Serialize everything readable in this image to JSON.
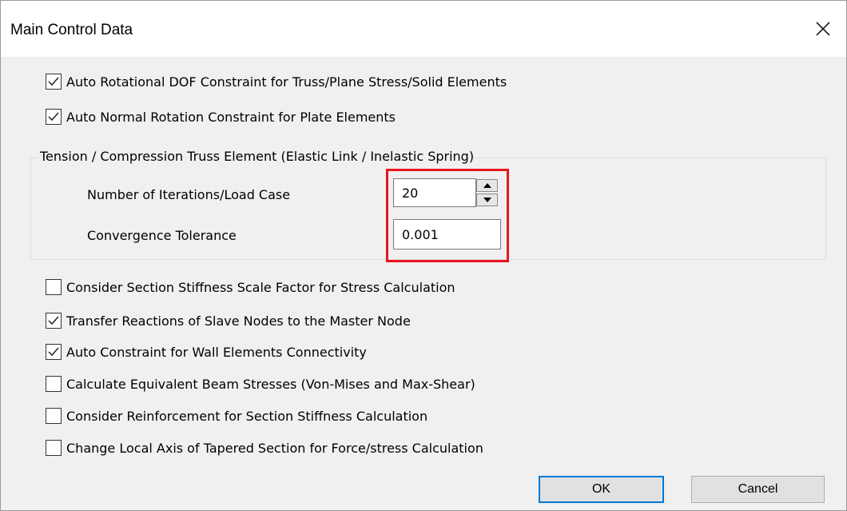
{
  "dialog": {
    "title": "Main Control Data",
    "close_icon": "close-icon"
  },
  "top_options": [
    {
      "label": "Auto Rotational DOF Constraint for Truss/Plane Stress/Solid Elements",
      "checked": true
    },
    {
      "label": "Auto Normal Rotation Constraint for Plate Elements",
      "checked": true
    }
  ],
  "group": {
    "title": "Tension / Compression Truss Element (Elastic Link / Inelastic Spring)",
    "iterations_label": "Number of Iterations/Load Case",
    "iterations_value": "20",
    "tolerance_label": "Convergence Tolerance",
    "tolerance_value": "0.001",
    "highlight_color": "#e8141e"
  },
  "bottom_options": [
    {
      "label": "Consider Section Stiffness Scale Factor for Stress Calculation",
      "checked": false
    },
    {
      "label": "Transfer Reactions of Slave Nodes to the Master Node",
      "checked": true
    },
    {
      "label": "Auto Constraint for Wall Elements Connectivity",
      "checked": true
    },
    {
      "label": "Calculate Equivalent Beam Stresses (Von-Mises and Max-Shear)",
      "checked": false
    },
    {
      "label": "Consider Reinforcement for Section Stiffness Calculation",
      "checked": false
    },
    {
      "label": "Change Local Axis of Tapered Section for Force/stress Calculation",
      "checked": false
    }
  ],
  "buttons": {
    "ok": "OK",
    "cancel": "Cancel"
  },
  "colors": {
    "accent": "#0078d7",
    "dialog_bg": "#f0f0f0"
  }
}
